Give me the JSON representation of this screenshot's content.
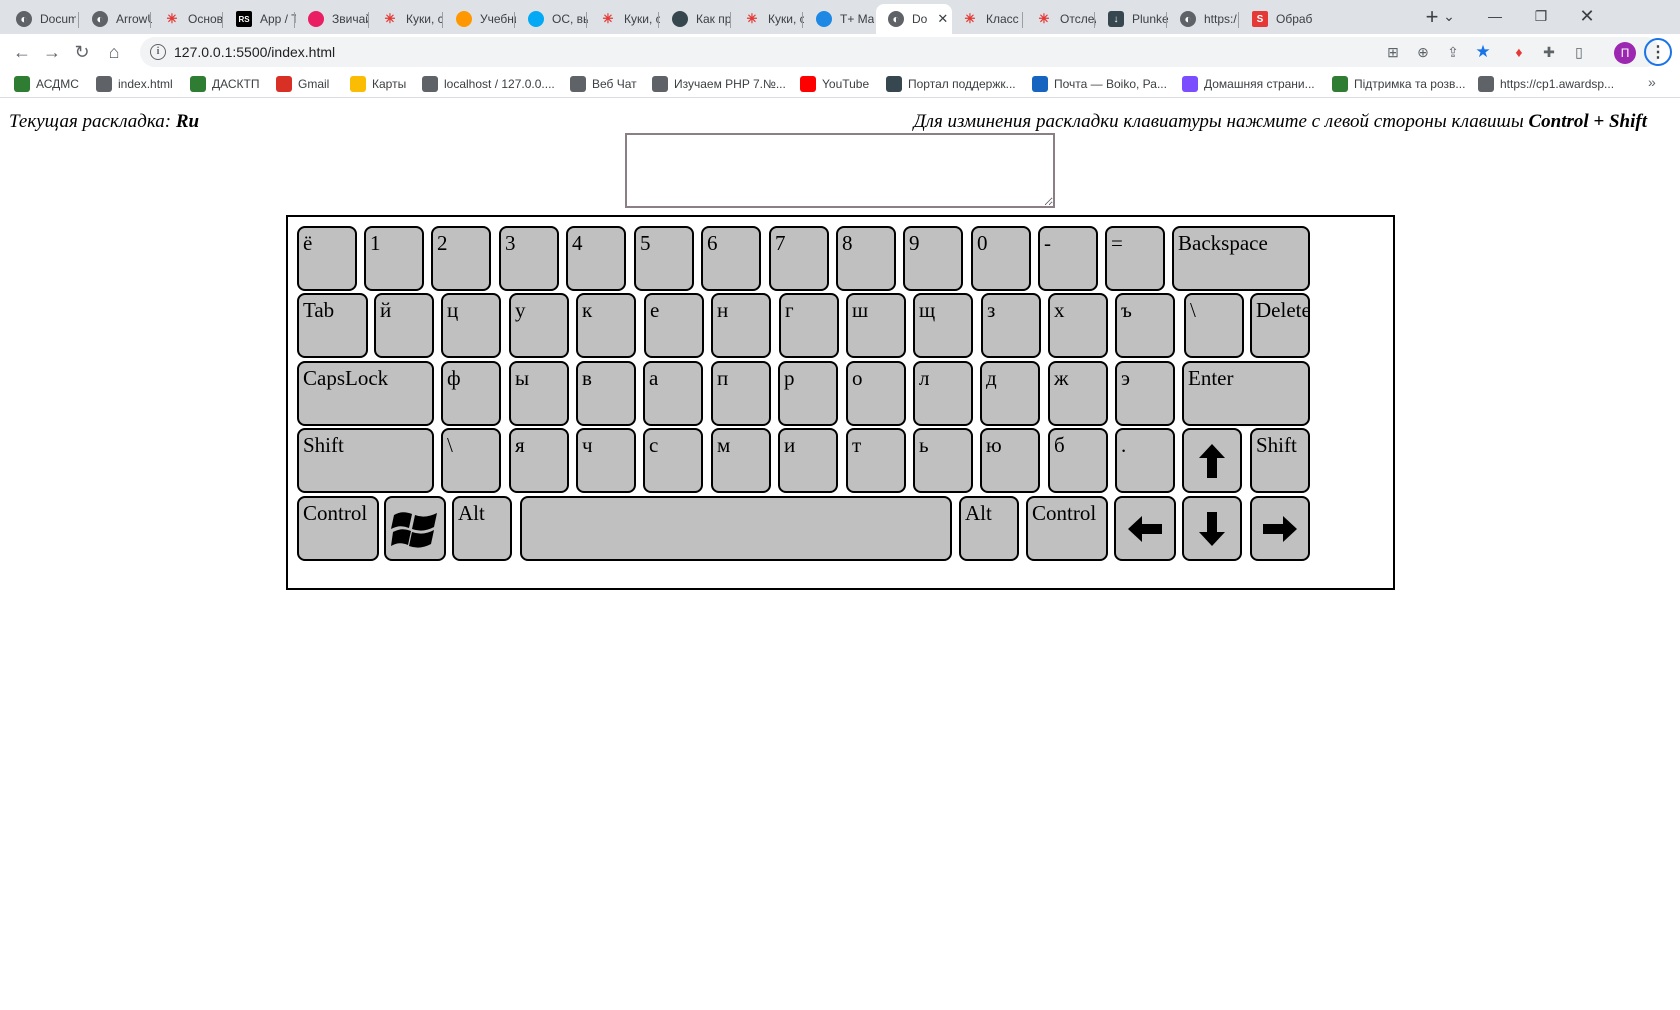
{
  "browser": {
    "tabs": [
      {
        "label": "Docum",
        "icon": "globe-icon",
        "color": "#5f6368"
      },
      {
        "label": "ArrowU",
        "icon": "globe-icon",
        "color": "#5f6368"
      },
      {
        "label": "Основ",
        "icon": "huawei-icon",
        "color": "#e53935"
      },
      {
        "label": "App / T",
        "icon": "rs-icon",
        "color": "#000000"
      },
      {
        "label": "Звичай",
        "icon": "app-icon",
        "color": "#e91e63"
      },
      {
        "label": "Куки, с",
        "icon": "huawei-icon",
        "color": "#e53935"
      },
      {
        "label": "Учебни",
        "icon": "app-icon",
        "color": "#ff9800"
      },
      {
        "label": "ОС, вы",
        "icon": "app-icon",
        "color": "#03a9f4"
      },
      {
        "label": "Куки, с",
        "icon": "huawei-icon",
        "color": "#e53935"
      },
      {
        "label": "Как пр",
        "icon": "app-icon",
        "color": "#37474f"
      },
      {
        "label": "Куки, с",
        "icon": "huawei-icon",
        "color": "#e53935"
      },
      {
        "label": "T+ Ma",
        "icon": "app-icon",
        "color": "#1e88e5"
      },
      {
        "label": "Do",
        "icon": "globe-icon",
        "color": "#5f6368",
        "active": true
      },
      {
        "label": "Класс",
        "icon": "huawei-icon",
        "color": "#e53935"
      },
      {
        "label": "Отслед",
        "icon": "huawei-icon",
        "color": "#e53935"
      },
      {
        "label": "Plunke",
        "icon": "download-icon",
        "color": "#37474f"
      },
      {
        "label": "https:/",
        "icon": "globe-icon",
        "color": "#5f6368"
      },
      {
        "label": "Обраб",
        "icon": "s-icon",
        "color": "#e53935"
      }
    ],
    "url": "127.0.0.1:5500/index.html",
    "profile_initial": "П",
    "bookmarks": [
      {
        "label": "АСДМС",
        "color": "#2e7d32"
      },
      {
        "label": "index.html",
        "color": "#5f6368"
      },
      {
        "label": "ДАСКТП",
        "color": "#2e7d32"
      },
      {
        "label": "Gmail",
        "color": "#d93025"
      },
      {
        "label": "Карты",
        "color": "#fbbc04"
      },
      {
        "label": "localhost / 127.0.0....",
        "color": "#5f6368"
      },
      {
        "label": "Веб Чат",
        "color": "#5f6368"
      },
      {
        "label": "Изучаем PHP 7.№...",
        "color": "#5f6368"
      },
      {
        "label": "YouTube",
        "color": "#ff0000"
      },
      {
        "label": "Портал поддержк...",
        "color": "#37474f"
      },
      {
        "label": "Почта — Boiko, Ра...",
        "color": "#1565c0"
      },
      {
        "label": "Домашняя страни...",
        "color": "#7c4dff"
      },
      {
        "label": "Підтримка та розв...",
        "color": "#2e7d32"
      },
      {
        "label": "https://cp1.awardsp...",
        "color": "#5f6368"
      }
    ]
  },
  "page": {
    "status_prefix": "Текущая раскладка:",
    "status_value": "Ru",
    "hint_prefix": "Для изминения раскладки клавиатуры нажмите с левой стороны клавишы",
    "hint_combo": "Control + Shift",
    "textarea_value": ""
  },
  "keyboard": {
    "rows": [
      [
        "ё",
        "1",
        "2",
        "3",
        "4",
        "5",
        "6",
        "7",
        "8",
        "9",
        "0",
        "-",
        "=",
        "Backspace"
      ],
      [
        "Tab",
        "й",
        "ц",
        "у",
        "к",
        "е",
        "н",
        "г",
        "ш",
        "щ",
        "з",
        "х",
        "ъ",
        "\\",
        "Delete"
      ],
      [
        "CapsLock",
        "ф",
        "ы",
        "в",
        "а",
        "п",
        "р",
        "о",
        "л",
        "д",
        "ж",
        "э",
        "Enter"
      ],
      [
        "Shift",
        "\\",
        "я",
        "ч",
        "с",
        "м",
        "и",
        "т",
        "ь",
        "ю",
        "б",
        ".",
        "↑",
        "Shift"
      ],
      [
        "Control",
        "win",
        "Alt",
        "",
        "Alt",
        "Control",
        "←",
        "↓",
        "→"
      ]
    ]
  }
}
